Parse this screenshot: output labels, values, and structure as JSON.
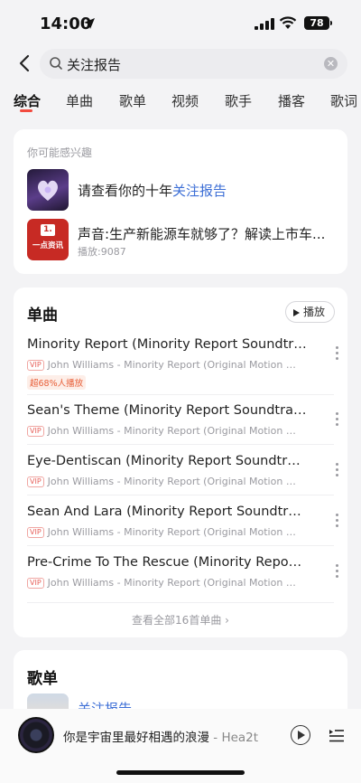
{
  "status_bar": {
    "time": "14:00",
    "battery": "78"
  },
  "search": {
    "query": "关注报告"
  },
  "tabs": [
    {
      "label": "综合",
      "active": true
    },
    {
      "label": "单曲"
    },
    {
      "label": "歌单"
    },
    {
      "label": "视频"
    },
    {
      "label": "歌手"
    },
    {
      "label": "播客"
    },
    {
      "label": "歌词"
    }
  ],
  "interest": {
    "title": "你可能感兴趣",
    "items": [
      {
        "title_prefix": "请查看你的十年",
        "title_highlight": "关注报告"
      },
      {
        "title": "声音:生产新能源车就够了？解读上市车...",
        "subtitle": "播放:9087",
        "thumb_text": "一点资讯"
      }
    ]
  },
  "singles": {
    "title": "单曲",
    "play_label": "播放",
    "songs": [
      {
        "name": "Minority Report (Minority Report Soundtrack)",
        "meta": "John Williams - Minority Report (Original Motion Pic...",
        "vip": "VIP",
        "tag": "超68%人播放"
      },
      {
        "name": "Sean's Theme (Minority Report Soundtrack)",
        "meta": "John Williams - Minority Report (Original Motion Pic...",
        "vip": "VIP"
      },
      {
        "name": "Eye-Dentiscan (Minority Report Soundtrack)",
        "meta": "John Williams - Minority Report (Original Motion Pic...",
        "vip": "VIP"
      },
      {
        "name": "Sean And Lara (Minority Report Soundtrack)",
        "meta": "John Williams - Minority Report (Original Motion Pic...",
        "vip": "VIP"
      },
      {
        "name": "Pre-Crime To The Rescue (Minority Report...",
        "meta": "John Williams - Minority Report (Original Motion Pic...",
        "vip": "VIP"
      }
    ],
    "view_all": "查看全部16首单曲 ›"
  },
  "playlists": {
    "title": "歌单",
    "first_item": "关注报告"
  },
  "player": {
    "title": "你是宇宙里最好相遇的浪漫",
    "artist": " - Hea2t"
  },
  "colors": {
    "accent": "#f24a3e",
    "link": "#3d6fd6"
  }
}
